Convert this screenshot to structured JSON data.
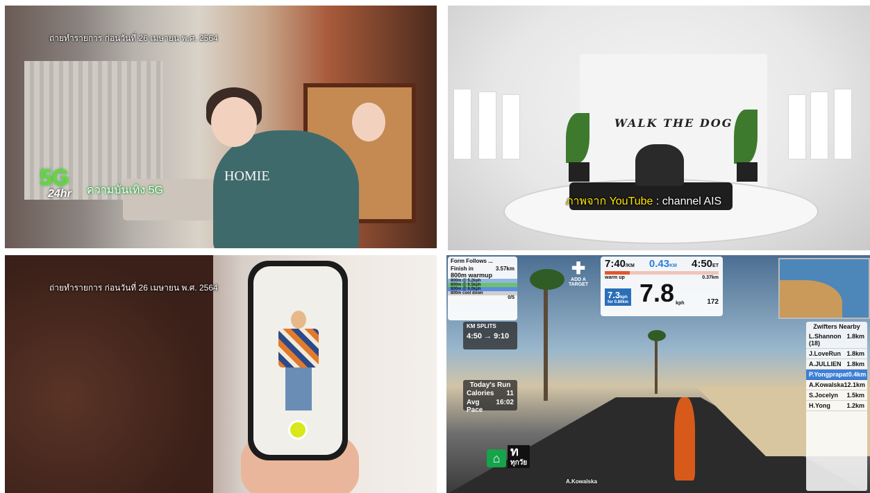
{
  "panel1": {
    "caption": "ถ่ายทำรายการ ก่อนวันที่ 26 เมษายน พ.ศ. 2564",
    "logo_5g": "5G",
    "logo_24hr": "24hr",
    "subtitle": "ความบันเทิง 5G",
    "shirt_text": "HOMIE"
  },
  "panel2": {
    "title": "WALK THE DOG",
    "source_prefix": "ภาพจาก YouTube",
    "source_suffix": ": channel AIS"
  },
  "panel3": {
    "caption": "ถ่ายทำรายการ ก่อนวันที่ 26 เมษายน พ.ศ. 2564"
  },
  "panel4": {
    "workout": {
      "title": "Form Follows ...",
      "finish_label": "Finish in",
      "finish_value": "3.57km",
      "warmup": "800m warmup",
      "steps": [
        "800m @ 5.2kph",
        "800m @ 6.5kph",
        "800m @ 6.0kph",
        "800m cool down"
      ],
      "step_count": "0/5"
    },
    "add_target": "ADD A TARGET",
    "stats": {
      "pace": "7:40",
      "pace_unit": "/KM",
      "distance": "0.43",
      "distance_unit": "KM",
      "time": "4:50",
      "time_unit": "ET",
      "interval_label": "warm up",
      "interval_value": "7.3",
      "interval_unit": "kph",
      "interval_sub": "for 0.80km",
      "interval_remaining": "0.37km",
      "speed": "7.8",
      "speed_unit": "kph",
      "cadence": "172"
    },
    "splits": {
      "title": "KM SPLITS",
      "from": "4:50",
      "to": "9:10"
    },
    "todays_run": {
      "title": "Today's Run",
      "rows": [
        {
          "label": "Calories",
          "value": "11"
        },
        {
          "label": "Avg Pace",
          "value": "16:02"
        }
      ]
    },
    "nearby": {
      "title": "Zwifters Nearby",
      "riders": [
        {
          "name": "L.Shannon (18)",
          "value": "1.8km",
          "highlight": false
        },
        {
          "name": "J.LoveRun",
          "value": "1.8km",
          "highlight": false
        },
        {
          "name": "A.JULLIEN",
          "value": "1.8km",
          "highlight": false
        },
        {
          "name": "P.Yongprapat",
          "value": "0.4km",
          "highlight": true
        },
        {
          "name": "A.Kowalska",
          "value": "12.1km",
          "highlight": false
        },
        {
          "name": "S.Jocelyn",
          "value": "1.5km",
          "highlight": false
        },
        {
          "name": "H.Yong",
          "value": "1.2km",
          "highlight": false
        }
      ]
    },
    "runner_tag": "A.Kowalska",
    "channel_glyph": "ท",
    "channel_name": "ทุกวัย"
  }
}
